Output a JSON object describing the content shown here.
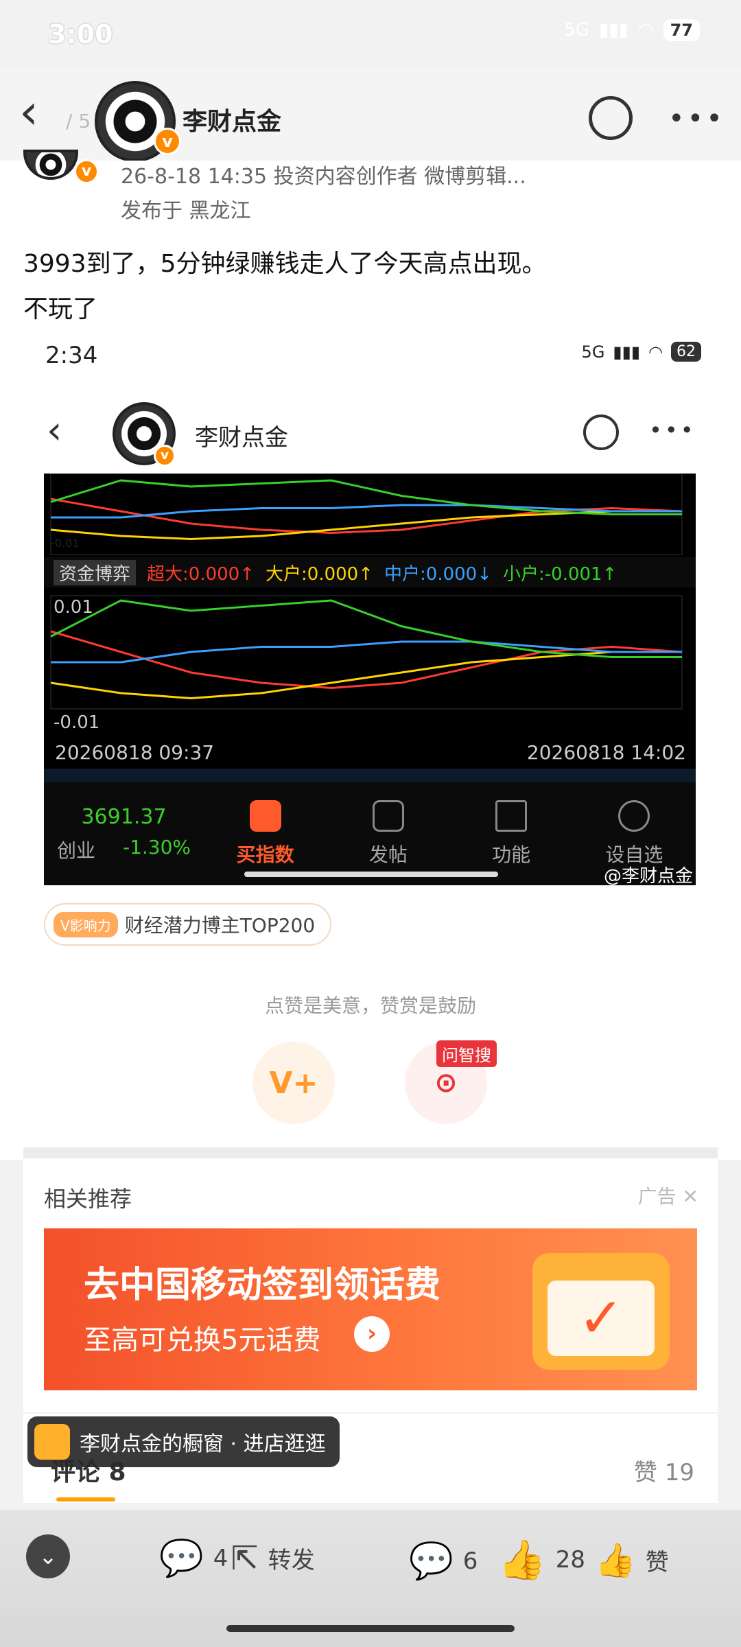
{
  "status_bar": {
    "time": "3:00",
    "network": "5G",
    "battery": "77"
  },
  "header": {
    "title": "李财点金",
    "page_indicator": "/ 5"
  },
  "post": {
    "meta": "26-8-18 14:35   投资内容创作者 微博剪辑...",
    "location": "发布于 黑龙江",
    "text_line1": "3993到了，5分钟绿赚钱走人了今天高点出现。",
    "text_line2": "不玩了"
  },
  "inner_screenshot": {
    "time": "2:34",
    "network": "5G",
    "battery": "62",
    "title": "李财点金",
    "legend": {
      "title": "资金博弈",
      "items": [
        {
          "label": "超大:0.000",
          "arrow": "↑",
          "color": "#ff3b30"
        },
        {
          "label": "大户:0.000",
          "arrow": "↑",
          "color": "#ffd400"
        },
        {
          "label": "中户:0.000",
          "arrow": "↓",
          "color": "#3ba0ff"
        },
        {
          "label": "小户:-0.001",
          "arrow": "↑",
          "color": "#38d02b"
        }
      ]
    },
    "axis": {
      "top": "0.01",
      "bottom": "-0.01",
      "prev_bottom": "-0.01"
    },
    "time_start": "20260818 09:37",
    "time_end": "20260818 14:02",
    "nav": {
      "index_value": "3691.37",
      "index_name": "创业",
      "index_change": "-1.30%",
      "items": [
        "买指数",
        "发帖",
        "功能",
        "设自选"
      ]
    },
    "watermark": "@李财点金"
  },
  "influence": {
    "tag": "V影响力",
    "text": "财经潜力博主TOP200"
  },
  "like_hint": "点赞是美意，赞赏是鼓励",
  "reward_label": "V+",
  "ask_tag": "问智搜",
  "recommend": {
    "title": "相关推荐",
    "ad_label": "广告"
  },
  "ad": {
    "main": "去中国移动签到领话费",
    "sub": "至高可兑换5元话费"
  },
  "shop": {
    "text": "李财点金的橱窗 · 进店逛逛"
  },
  "comments": {
    "label": "评论 8",
    "likes": "赞 19"
  },
  "bottom": {
    "forward_count": "4",
    "forward_label": "转发",
    "comment_count": "6",
    "like_count": "28",
    "like_label": "赞"
  },
  "colors": {
    "red": "#ff3b30",
    "yellow": "#ffd400",
    "blue": "#3ba0ff",
    "green": "#38d02b",
    "accent": "#ff8a00"
  },
  "chart_data": [
    {
      "type": "line",
      "title": "资金博弈",
      "x": [
        "09:37",
        "14:02"
      ],
      "ylim": [
        -0.01,
        0.01
      ],
      "series": [
        {
          "name": "超大",
          "values": [
            0.004,
            0.0,
            -0.004,
            -0.006,
            -0.007,
            -0.006,
            -0.003,
            0.0,
            0.001,
            0.0
          ]
        },
        {
          "name": "大户",
          "values": [
            -0.006,
            -0.008,
            -0.009,
            -0.008,
            -0.006,
            -0.004,
            -0.002,
            -0.001,
            0.0,
            0.0
          ]
        },
        {
          "name": "中户",
          "values": [
            -0.002,
            -0.002,
            0.0,
            0.001,
            0.001,
            0.002,
            0.002,
            0.001,
            0.0,
            0.0
          ]
        },
        {
          "name": "小户",
          "values": [
            0.003,
            0.01,
            0.008,
            0.009,
            0.01,
            0.005,
            0.002,
            0.0,
            -0.001,
            -0.001
          ]
        }
      ]
    }
  ]
}
